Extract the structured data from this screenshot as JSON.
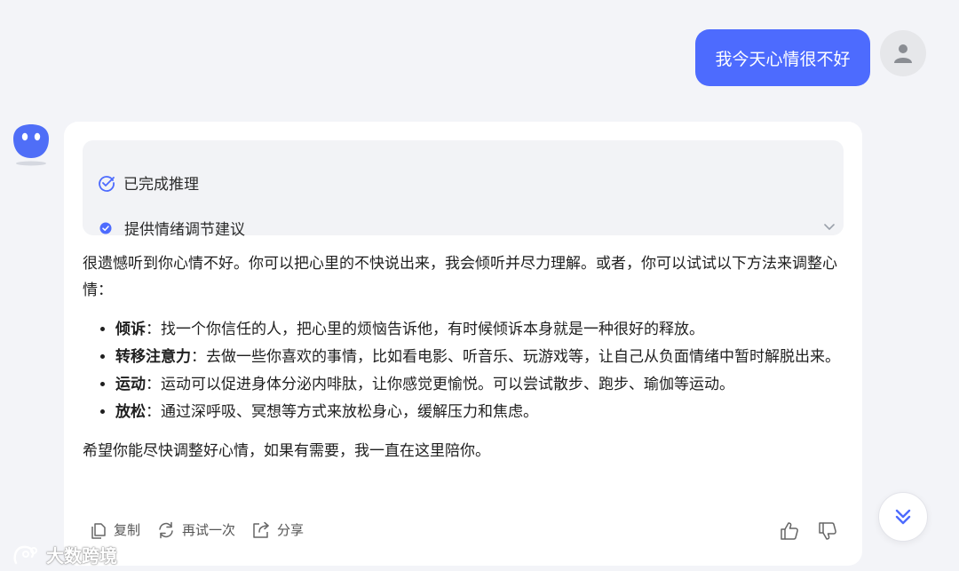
{
  "user_message": {
    "text": "我今天心情很不好"
  },
  "assistant": {
    "reasoning": {
      "status": "已完成推理",
      "step": "提供情绪调节建议"
    },
    "intro": "很遗憾听到你心情不好。你可以把心里的不快说出来，我会倾听并尽力理解。或者，你可以试试以下方法来调整心情：",
    "tips": [
      {
        "title": "倾诉",
        "text": "：找一个你信任的人，把心里的烦恼告诉他，有时候倾诉本身就是一种很好的释放。"
      },
      {
        "title": "转移注意力",
        "text": "：去做一些你喜欢的事情，比如看电影、听音乐、玩游戏等，让自己从负面情绪中暂时解脱出来。"
      },
      {
        "title": "运动",
        "text": "：运动可以促进身体分泌内啡肽，让你感觉更愉悦。可以尝试散步、跑步、瑜伽等运动。"
      },
      {
        "title": "放松",
        "text": "：通过深呼吸、冥想等方式来放松身心，缓解压力和焦虑。"
      }
    ],
    "closing": "希望你能尽快调整好心情，如果有需要，我一直在这里陪你。",
    "actions": {
      "copy": "复制",
      "retry": "再试一次",
      "share": "分享"
    }
  },
  "watermark": {
    "text": "大数跨境"
  },
  "colors": {
    "accent": "#4d6bfe",
    "background": "#f3f4f8",
    "card": "#ffffff",
    "reasoning_bg": "#f2f3f6"
  },
  "icons": [
    "user-avatar-icon",
    "bot-avatar-icon",
    "check-circle-icon",
    "step-dot-icon",
    "chevron-down-icon",
    "copy-icon",
    "retry-icon",
    "share-icon",
    "thumbs-up-icon",
    "thumbs-down-icon",
    "scroll-down-icon"
  ]
}
